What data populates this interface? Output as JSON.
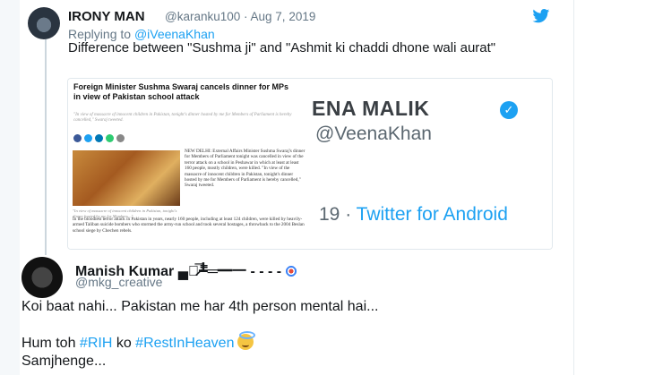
{
  "tweet1": {
    "name": "IRONY MAN",
    "handle": "@karanku100",
    "date": "· Aug 7, 2019",
    "replying_prefix": "Replying to ",
    "replying_handle": "@iVeenaKhan",
    "text": "Difference between \"Sushma ji\" and \"Ashmit ki chaddi dhone wali aurat\""
  },
  "media": {
    "article_title": "Foreign Minister Sushma Swaraj cancels dinner for MPs in view of Pakistan school attack",
    "article_sub": "\"In view of massacre of innocent children in Pakistan, tonight's dinner hosted by me for Members of Parliament is hereby cancelled,\" Swaraj tweeted.",
    "article_col": "NEW DELHI: External Affairs Minister Sushma Swaraj's dinner for Members of Parliament tonight was cancelled in view of the terror attack on a school in Peshawar in which at least at least 160 people, mostly children, were killed. \"In view of the massacre of innocent children in Pakistan, tonight's dinner hosted by me for Members of Parliament is hereby cancelled,\" Swaraj tweeted.",
    "article_cap": "\"In view of massacre of innocent children in Pakistan, tonight's dinner hosted by me for Members...\"",
    "article_body": "In the bloodiest terror attack in Pakistan in years, nearly 160 people, including at least 124 children, were killed by heavily-armed Taliban suicide bombers who stormed the army-run school and took several hostages, a throwback to the 2004 Beslan school siege by Chechen rebels.",
    "bg_name": "ENA MALIK",
    "bg_handle": "VeenaKhan",
    "bg_source_num": "19 · ",
    "bg_source_app": "Twitter for Android"
  },
  "tweet2": {
    "name": "Manish Kumar ▄︻̷̿┻̿═━一 - - - -",
    "handle": "@mkg_creative",
    "line1": "Koi baat nahi... Pakistan me har 4th person mental hai...",
    "line2_prefix": "Hum toh ",
    "hashtag1": "#RIH",
    "line2_mid": " ko ",
    "hashtag2": "#RestInHeaven",
    "line3": "Samjhenge..."
  },
  "colors": {
    "link": "#1da1f2",
    "text": "#14171a",
    "muted": "#657786"
  },
  "icons": [
    "twitter-bird-icon",
    "verified-badge-icon",
    "target-emoji-icon",
    "halo-smile-emoji-icon"
  ]
}
